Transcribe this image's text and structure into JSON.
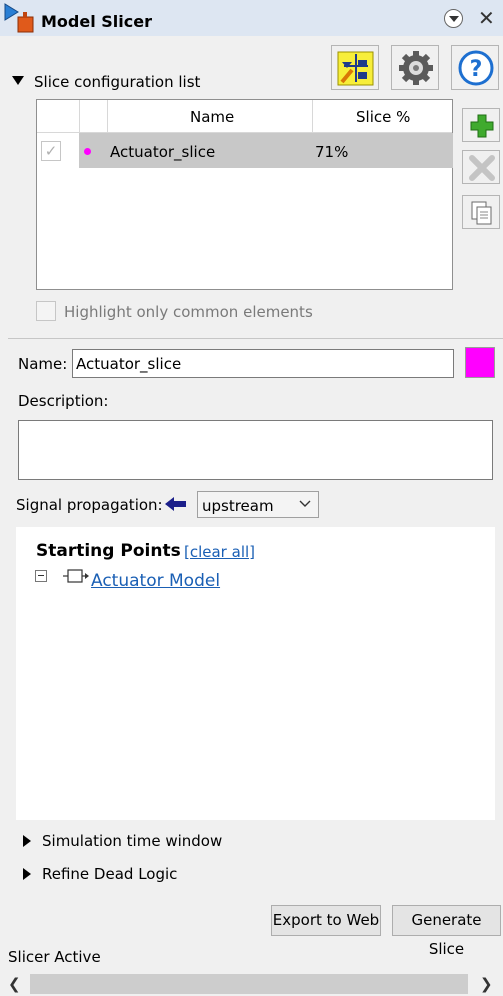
{
  "window": {
    "title": "Model Slicer",
    "close_glyph": "✕"
  },
  "toolbar": {
    "buttons": [
      {
        "icon": "highlight-slice-icon",
        "tooltip": ""
      },
      {
        "icon": "gear-icon",
        "tooltip": ""
      },
      {
        "icon": "help-icon",
        "tooltip": ""
      }
    ]
  },
  "slice_config": {
    "section_label": "Slice configuration list",
    "columns": {
      "name": "Name",
      "slice_pct": "Slice %"
    },
    "rows": [
      {
        "checked": true,
        "color": "#ff00ff",
        "name": "Actuator_slice",
        "slice_pct": "71%"
      }
    ],
    "check_glyph": "✓",
    "highlight_common_label": "Highlight only common elements",
    "side_buttons": [
      "add-icon",
      "delete-icon",
      "copy-icon"
    ]
  },
  "details": {
    "name_label": "Name:",
    "name_value": "Actuator_slice",
    "highlight_color": "#ff00ff",
    "description_label": "Description:",
    "description_value": ""
  },
  "propagation": {
    "label": "Signal propagation:",
    "arrow_icon": "upstream-arrow-icon",
    "selected": "upstream"
  },
  "starting_points": {
    "title": "Starting Points",
    "clear_all": "[clear all]",
    "items": [
      {
        "name": "Actuator Model",
        "icon": "subsystem-block-icon",
        "expanded": true
      }
    ]
  },
  "collapsed_sections": [
    {
      "label": "Simulation time window"
    },
    {
      "label": "Refine Dead Logic"
    }
  ],
  "actions": {
    "export_label": "Export to Web",
    "generate_label": "Generate Slice"
  },
  "status": {
    "text": "Slicer Active"
  },
  "scrollbar": {
    "left_glyph": "❮",
    "right_glyph": "❯"
  }
}
